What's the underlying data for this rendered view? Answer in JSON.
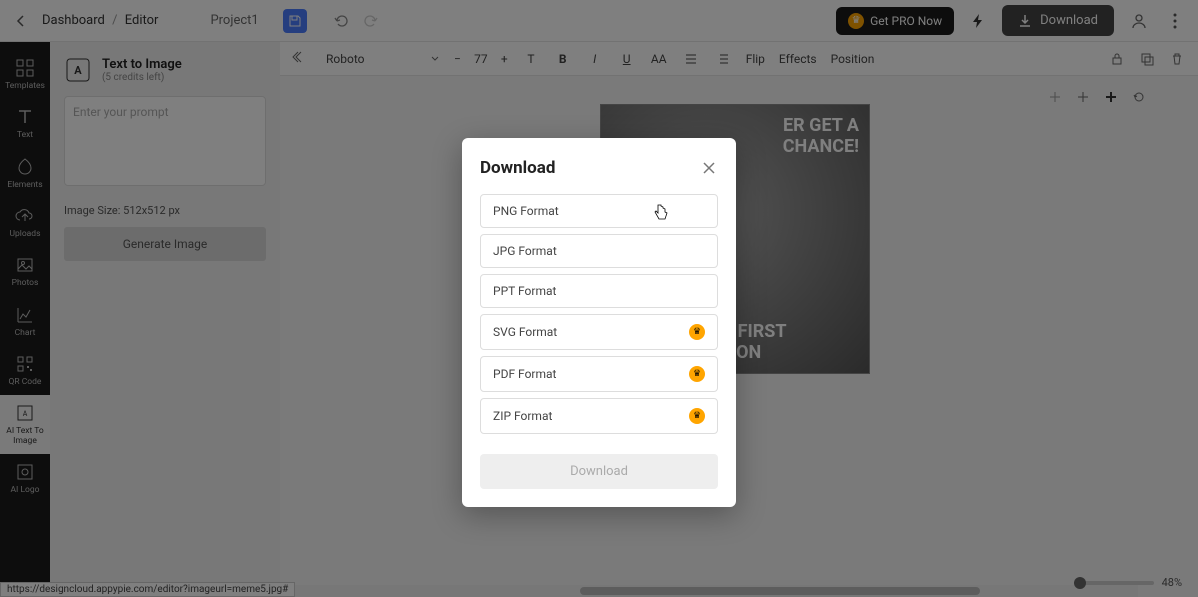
{
  "topbar": {
    "breadcrumb_home": "Dashboard",
    "breadcrumb_current": "Editor",
    "project_name": "Project1",
    "get_pro_label": "Get PRO Now",
    "download_label": "Download"
  },
  "sidebar": {
    "items": [
      {
        "label": "Templates"
      },
      {
        "label": "Text"
      },
      {
        "label": "Elements"
      },
      {
        "label": "Uploads"
      },
      {
        "label": "Photos"
      },
      {
        "label": "Chart"
      },
      {
        "label": "QR Code"
      },
      {
        "label": "AI Text To Image"
      },
      {
        "label": "AI Logo"
      }
    ]
  },
  "panel": {
    "title": "Text to Image",
    "credits_note": "(5 credits left)",
    "prompt_placeholder": "Enter your prompt",
    "image_size_label": "Image Size:",
    "image_size_value": "512x512 px",
    "generate_label": "Generate Image"
  },
  "format_bar": {
    "font_name": "Roboto",
    "font_size": "77",
    "flip_label": "Flip",
    "effects_label": "Effects",
    "position_label": "Position"
  },
  "canvas": {
    "text_top": "ER GET A\nCHANCE!",
    "text_bottom": "P THE FIRST\nSSION",
    "zoom_percent": "48%"
  },
  "modal": {
    "title": "Download",
    "options": [
      {
        "label": "PNG Format",
        "pro": false
      },
      {
        "label": "JPG Format",
        "pro": false
      },
      {
        "label": "PPT Format",
        "pro": false
      },
      {
        "label": "SVG Format",
        "pro": true
      },
      {
        "label": "PDF Format",
        "pro": true
      },
      {
        "label": "ZIP Format",
        "pro": true
      }
    ],
    "download_button": "Download"
  },
  "status_url": "https://designcloud.appypie.com/editor?imageurl=meme5.jpg#"
}
